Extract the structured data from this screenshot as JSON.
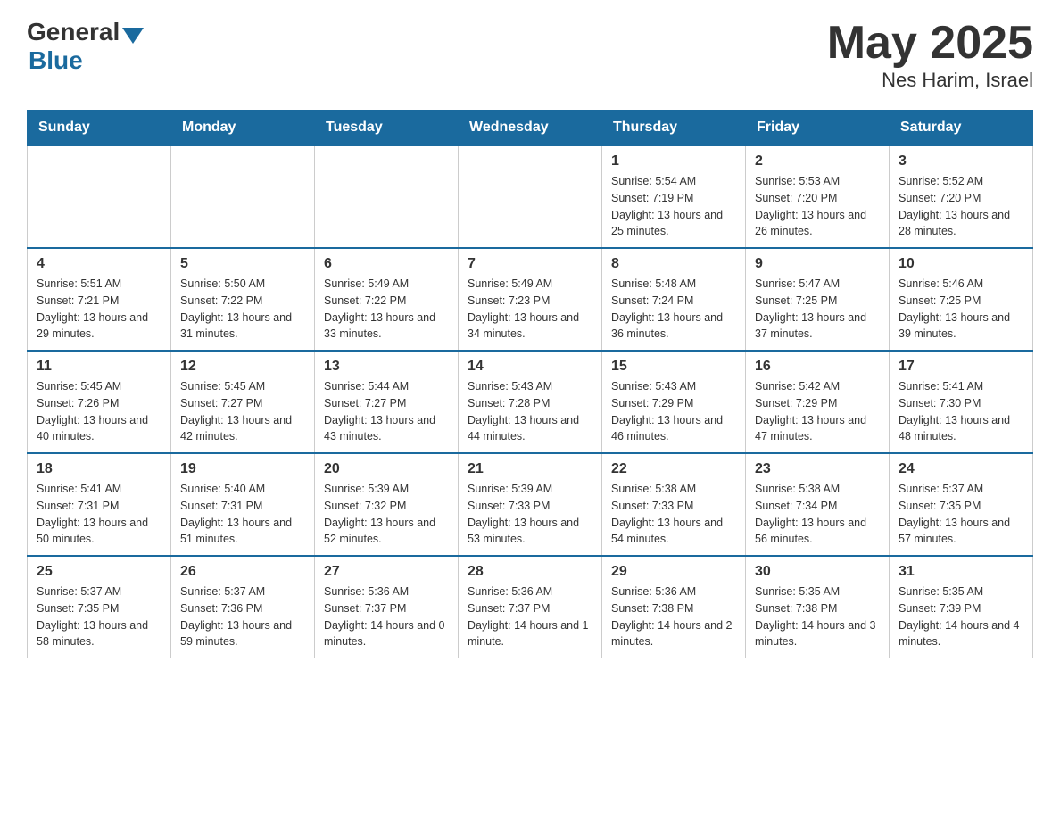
{
  "logo": {
    "general": "General",
    "blue": "Blue"
  },
  "title": "May 2025",
  "subtitle": "Nes Harim, Israel",
  "days_of_week": [
    "Sunday",
    "Monday",
    "Tuesday",
    "Wednesday",
    "Thursday",
    "Friday",
    "Saturday"
  ],
  "weeks": [
    [
      {
        "day": "",
        "sunrise": "",
        "sunset": "",
        "daylight": ""
      },
      {
        "day": "",
        "sunrise": "",
        "sunset": "",
        "daylight": ""
      },
      {
        "day": "",
        "sunrise": "",
        "sunset": "",
        "daylight": ""
      },
      {
        "day": "",
        "sunrise": "",
        "sunset": "",
        "daylight": ""
      },
      {
        "day": "1",
        "sunrise": "Sunrise: 5:54 AM",
        "sunset": "Sunset: 7:19 PM",
        "daylight": "Daylight: 13 hours and 25 minutes."
      },
      {
        "day": "2",
        "sunrise": "Sunrise: 5:53 AM",
        "sunset": "Sunset: 7:20 PM",
        "daylight": "Daylight: 13 hours and 26 minutes."
      },
      {
        "day": "3",
        "sunrise": "Sunrise: 5:52 AM",
        "sunset": "Sunset: 7:20 PM",
        "daylight": "Daylight: 13 hours and 28 minutes."
      }
    ],
    [
      {
        "day": "4",
        "sunrise": "Sunrise: 5:51 AM",
        "sunset": "Sunset: 7:21 PM",
        "daylight": "Daylight: 13 hours and 29 minutes."
      },
      {
        "day": "5",
        "sunrise": "Sunrise: 5:50 AM",
        "sunset": "Sunset: 7:22 PM",
        "daylight": "Daylight: 13 hours and 31 minutes."
      },
      {
        "day": "6",
        "sunrise": "Sunrise: 5:49 AM",
        "sunset": "Sunset: 7:22 PM",
        "daylight": "Daylight: 13 hours and 33 minutes."
      },
      {
        "day": "7",
        "sunrise": "Sunrise: 5:49 AM",
        "sunset": "Sunset: 7:23 PM",
        "daylight": "Daylight: 13 hours and 34 minutes."
      },
      {
        "day": "8",
        "sunrise": "Sunrise: 5:48 AM",
        "sunset": "Sunset: 7:24 PM",
        "daylight": "Daylight: 13 hours and 36 minutes."
      },
      {
        "day": "9",
        "sunrise": "Sunrise: 5:47 AM",
        "sunset": "Sunset: 7:25 PM",
        "daylight": "Daylight: 13 hours and 37 minutes."
      },
      {
        "day": "10",
        "sunrise": "Sunrise: 5:46 AM",
        "sunset": "Sunset: 7:25 PM",
        "daylight": "Daylight: 13 hours and 39 minutes."
      }
    ],
    [
      {
        "day": "11",
        "sunrise": "Sunrise: 5:45 AM",
        "sunset": "Sunset: 7:26 PM",
        "daylight": "Daylight: 13 hours and 40 minutes."
      },
      {
        "day": "12",
        "sunrise": "Sunrise: 5:45 AM",
        "sunset": "Sunset: 7:27 PM",
        "daylight": "Daylight: 13 hours and 42 minutes."
      },
      {
        "day": "13",
        "sunrise": "Sunrise: 5:44 AM",
        "sunset": "Sunset: 7:27 PM",
        "daylight": "Daylight: 13 hours and 43 minutes."
      },
      {
        "day": "14",
        "sunrise": "Sunrise: 5:43 AM",
        "sunset": "Sunset: 7:28 PM",
        "daylight": "Daylight: 13 hours and 44 minutes."
      },
      {
        "day": "15",
        "sunrise": "Sunrise: 5:43 AM",
        "sunset": "Sunset: 7:29 PM",
        "daylight": "Daylight: 13 hours and 46 minutes."
      },
      {
        "day": "16",
        "sunrise": "Sunrise: 5:42 AM",
        "sunset": "Sunset: 7:29 PM",
        "daylight": "Daylight: 13 hours and 47 minutes."
      },
      {
        "day": "17",
        "sunrise": "Sunrise: 5:41 AM",
        "sunset": "Sunset: 7:30 PM",
        "daylight": "Daylight: 13 hours and 48 minutes."
      }
    ],
    [
      {
        "day": "18",
        "sunrise": "Sunrise: 5:41 AM",
        "sunset": "Sunset: 7:31 PM",
        "daylight": "Daylight: 13 hours and 50 minutes."
      },
      {
        "day": "19",
        "sunrise": "Sunrise: 5:40 AM",
        "sunset": "Sunset: 7:31 PM",
        "daylight": "Daylight: 13 hours and 51 minutes."
      },
      {
        "day": "20",
        "sunrise": "Sunrise: 5:39 AM",
        "sunset": "Sunset: 7:32 PM",
        "daylight": "Daylight: 13 hours and 52 minutes."
      },
      {
        "day": "21",
        "sunrise": "Sunrise: 5:39 AM",
        "sunset": "Sunset: 7:33 PM",
        "daylight": "Daylight: 13 hours and 53 minutes."
      },
      {
        "day": "22",
        "sunrise": "Sunrise: 5:38 AM",
        "sunset": "Sunset: 7:33 PM",
        "daylight": "Daylight: 13 hours and 54 minutes."
      },
      {
        "day": "23",
        "sunrise": "Sunrise: 5:38 AM",
        "sunset": "Sunset: 7:34 PM",
        "daylight": "Daylight: 13 hours and 56 minutes."
      },
      {
        "day": "24",
        "sunrise": "Sunrise: 5:37 AM",
        "sunset": "Sunset: 7:35 PM",
        "daylight": "Daylight: 13 hours and 57 minutes."
      }
    ],
    [
      {
        "day": "25",
        "sunrise": "Sunrise: 5:37 AM",
        "sunset": "Sunset: 7:35 PM",
        "daylight": "Daylight: 13 hours and 58 minutes."
      },
      {
        "day": "26",
        "sunrise": "Sunrise: 5:37 AM",
        "sunset": "Sunset: 7:36 PM",
        "daylight": "Daylight: 13 hours and 59 minutes."
      },
      {
        "day": "27",
        "sunrise": "Sunrise: 5:36 AM",
        "sunset": "Sunset: 7:37 PM",
        "daylight": "Daylight: 14 hours and 0 minutes."
      },
      {
        "day": "28",
        "sunrise": "Sunrise: 5:36 AM",
        "sunset": "Sunset: 7:37 PM",
        "daylight": "Daylight: 14 hours and 1 minute."
      },
      {
        "day": "29",
        "sunrise": "Sunrise: 5:36 AM",
        "sunset": "Sunset: 7:38 PM",
        "daylight": "Daylight: 14 hours and 2 minutes."
      },
      {
        "day": "30",
        "sunrise": "Sunrise: 5:35 AM",
        "sunset": "Sunset: 7:38 PM",
        "daylight": "Daylight: 14 hours and 3 minutes."
      },
      {
        "day": "31",
        "sunrise": "Sunrise: 5:35 AM",
        "sunset": "Sunset: 7:39 PM",
        "daylight": "Daylight: 14 hours and 4 minutes."
      }
    ]
  ]
}
